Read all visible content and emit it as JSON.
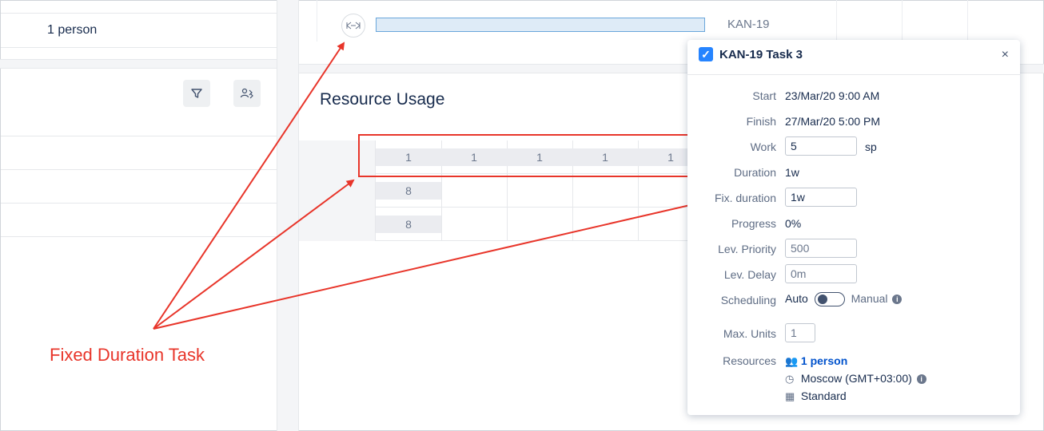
{
  "left": {
    "row_text": "1 person"
  },
  "toolbar": {
    "filter_icon": "filter-icon",
    "resources_icon": "people-settings-icon"
  },
  "gantt": {
    "task_icon_text": "⇱⇲",
    "task_key": "KAN-19"
  },
  "resource_usage": {
    "title": "Resource Usage",
    "row1": [
      "1",
      "1",
      "1",
      "1",
      "1"
    ],
    "row2": [
      "8"
    ],
    "row3": [
      "8"
    ]
  },
  "popup": {
    "title": "KAN-19 Task 3",
    "close": "×",
    "fields": {
      "start_label": "Start",
      "start_value": "23/Mar/20 9:00 AM",
      "finish_label": "Finish",
      "finish_value": "27/Mar/20 5:00 PM",
      "work_label": "Work",
      "work_value": "5",
      "work_unit": "sp",
      "duration_label": "Duration",
      "duration_value": "1w",
      "fix_duration_label": "Fix. duration",
      "fix_duration_value": "1w",
      "progress_label": "Progress",
      "progress_value": "0%",
      "lev_priority_label": "Lev. Priority",
      "lev_priority_value": "500",
      "lev_delay_label": "Lev. Delay",
      "lev_delay_value": "0m",
      "scheduling_label": "Scheduling",
      "scheduling_auto": "Auto",
      "scheduling_manual": "Manual",
      "max_units_label": "Max. Units",
      "max_units_value": "1",
      "resources_label": "Resources",
      "resources_value": "1 person",
      "timezone": "Moscow (GMT+03:00)",
      "calendar": "Standard"
    }
  },
  "annotation": {
    "text": "Fixed Duration Task"
  },
  "colors": {
    "accent": "#2684ff",
    "link": "#0052cc",
    "annotation": "#e8352a",
    "task_bar": "#deebf7"
  }
}
